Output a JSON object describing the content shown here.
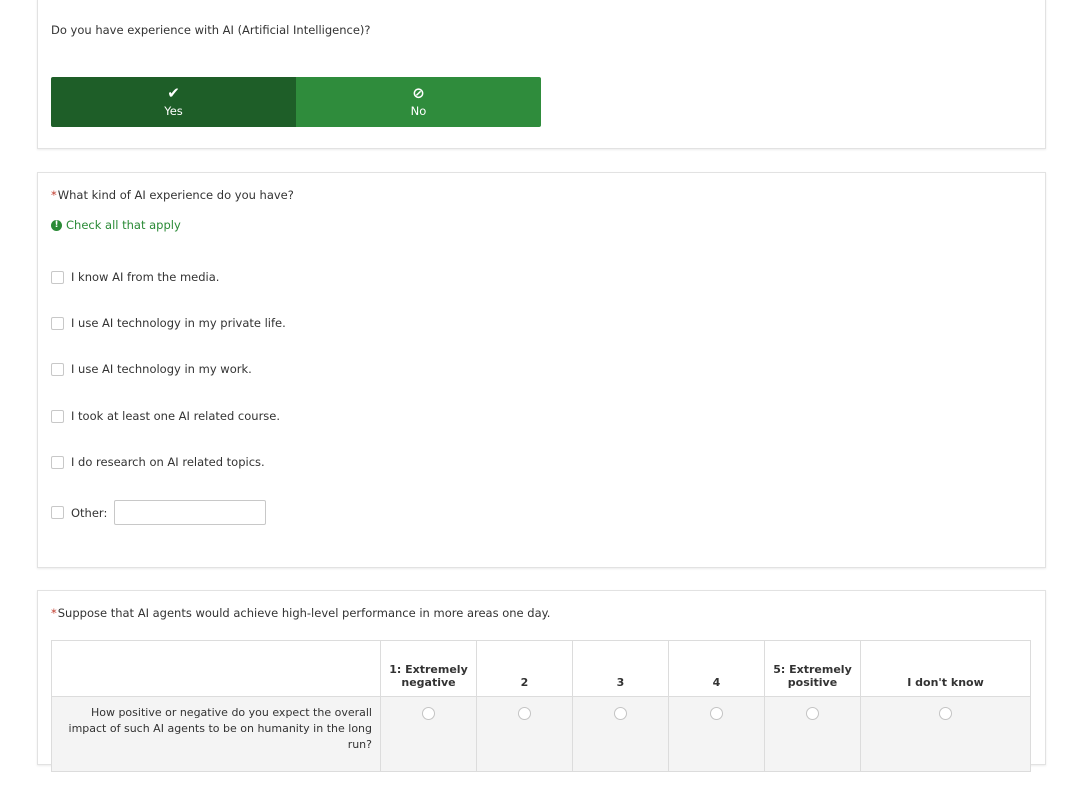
{
  "q1": {
    "question": "Do you have experience with AI (Artificial Intelligence)?",
    "yes": {
      "icon": "check-icon",
      "glyph": "✔",
      "label": "Yes"
    },
    "no": {
      "icon": "ban-icon",
      "glyph": "⊘",
      "label": "No"
    },
    "selected": "Yes",
    "colors": {
      "selected": "#1e5e28",
      "unselected": "#2f8c3c"
    }
  },
  "q2": {
    "required_mark": "*",
    "question": "What kind of AI experience do you have?",
    "hint_icon": "info-icon",
    "hint_glyph": "!",
    "hint": "Check all that apply",
    "options": [
      "I know AI from the media.",
      "I use AI technology in my private life.",
      "I use AI technology in my work.",
      "I took at least one AI related course.",
      "I do research on AI related topics."
    ],
    "other_label": "Other:",
    "other_value": "",
    "hint_color": "#2a8a36"
  },
  "q3": {
    "required_mark": "*",
    "question": "Suppose that AI agents would achieve high-level performance in more areas one day.",
    "columns": [
      "1: Extremely negative",
      "2",
      "3",
      "4",
      "5: Extremely positive",
      "I don't know"
    ],
    "row": "How positive or negative do you expect the overall impact of such AI agents to be on humanity in the long run?"
  }
}
